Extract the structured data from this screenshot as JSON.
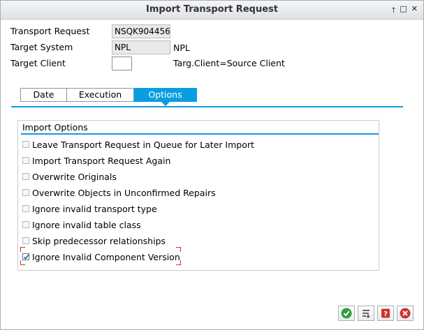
{
  "window": {
    "title": "Import Transport Request",
    "controls": [
      "up-arrow",
      "restore",
      "close"
    ],
    "control_glyphs": [
      "🡑",
      "□",
      "✕"
    ]
  },
  "form": {
    "transport_request": {
      "label": "Transport Request",
      "value": "NSQK904456"
    },
    "target_system": {
      "label": "Target System",
      "value": "NPL",
      "description": "NPL"
    },
    "target_client": {
      "label": "Target Client",
      "value": "",
      "description": "Targ.Client=Source Client"
    }
  },
  "tabs": [
    {
      "label": "Date",
      "active": false
    },
    {
      "label": "Execution",
      "active": false
    },
    {
      "label": "Options",
      "active": true
    }
  ],
  "options_group": {
    "title": "Import Options",
    "items": [
      {
        "label": "Leave Transport Request in Queue for Later Import",
        "checked": false
      },
      {
        "label": "Import Transport Request Again",
        "checked": false
      },
      {
        "label": "Overwrite Originals",
        "checked": false
      },
      {
        "label": "Overwrite Objects in Unconfirmed Repairs",
        "checked": false
      },
      {
        "label": "Ignore invalid transport type",
        "checked": false
      },
      {
        "label": "Ignore invalid table class",
        "checked": false
      },
      {
        "label": "Skip predecessor relationships",
        "checked": false
      },
      {
        "label": "Ignore Invalid Component Version",
        "checked": true
      }
    ]
  },
  "footer_buttons": [
    {
      "icon": "checkmark-icon",
      "color": "#2e9e3e"
    },
    {
      "icon": "import-list-icon",
      "color": "#333333"
    },
    {
      "icon": "help-icon",
      "color": "#d0312d"
    },
    {
      "icon": "cancel-icon",
      "color": "#d0312d"
    }
  ],
  "colors": {
    "accent": "#0a9ee0",
    "focus": "#c0392b"
  }
}
